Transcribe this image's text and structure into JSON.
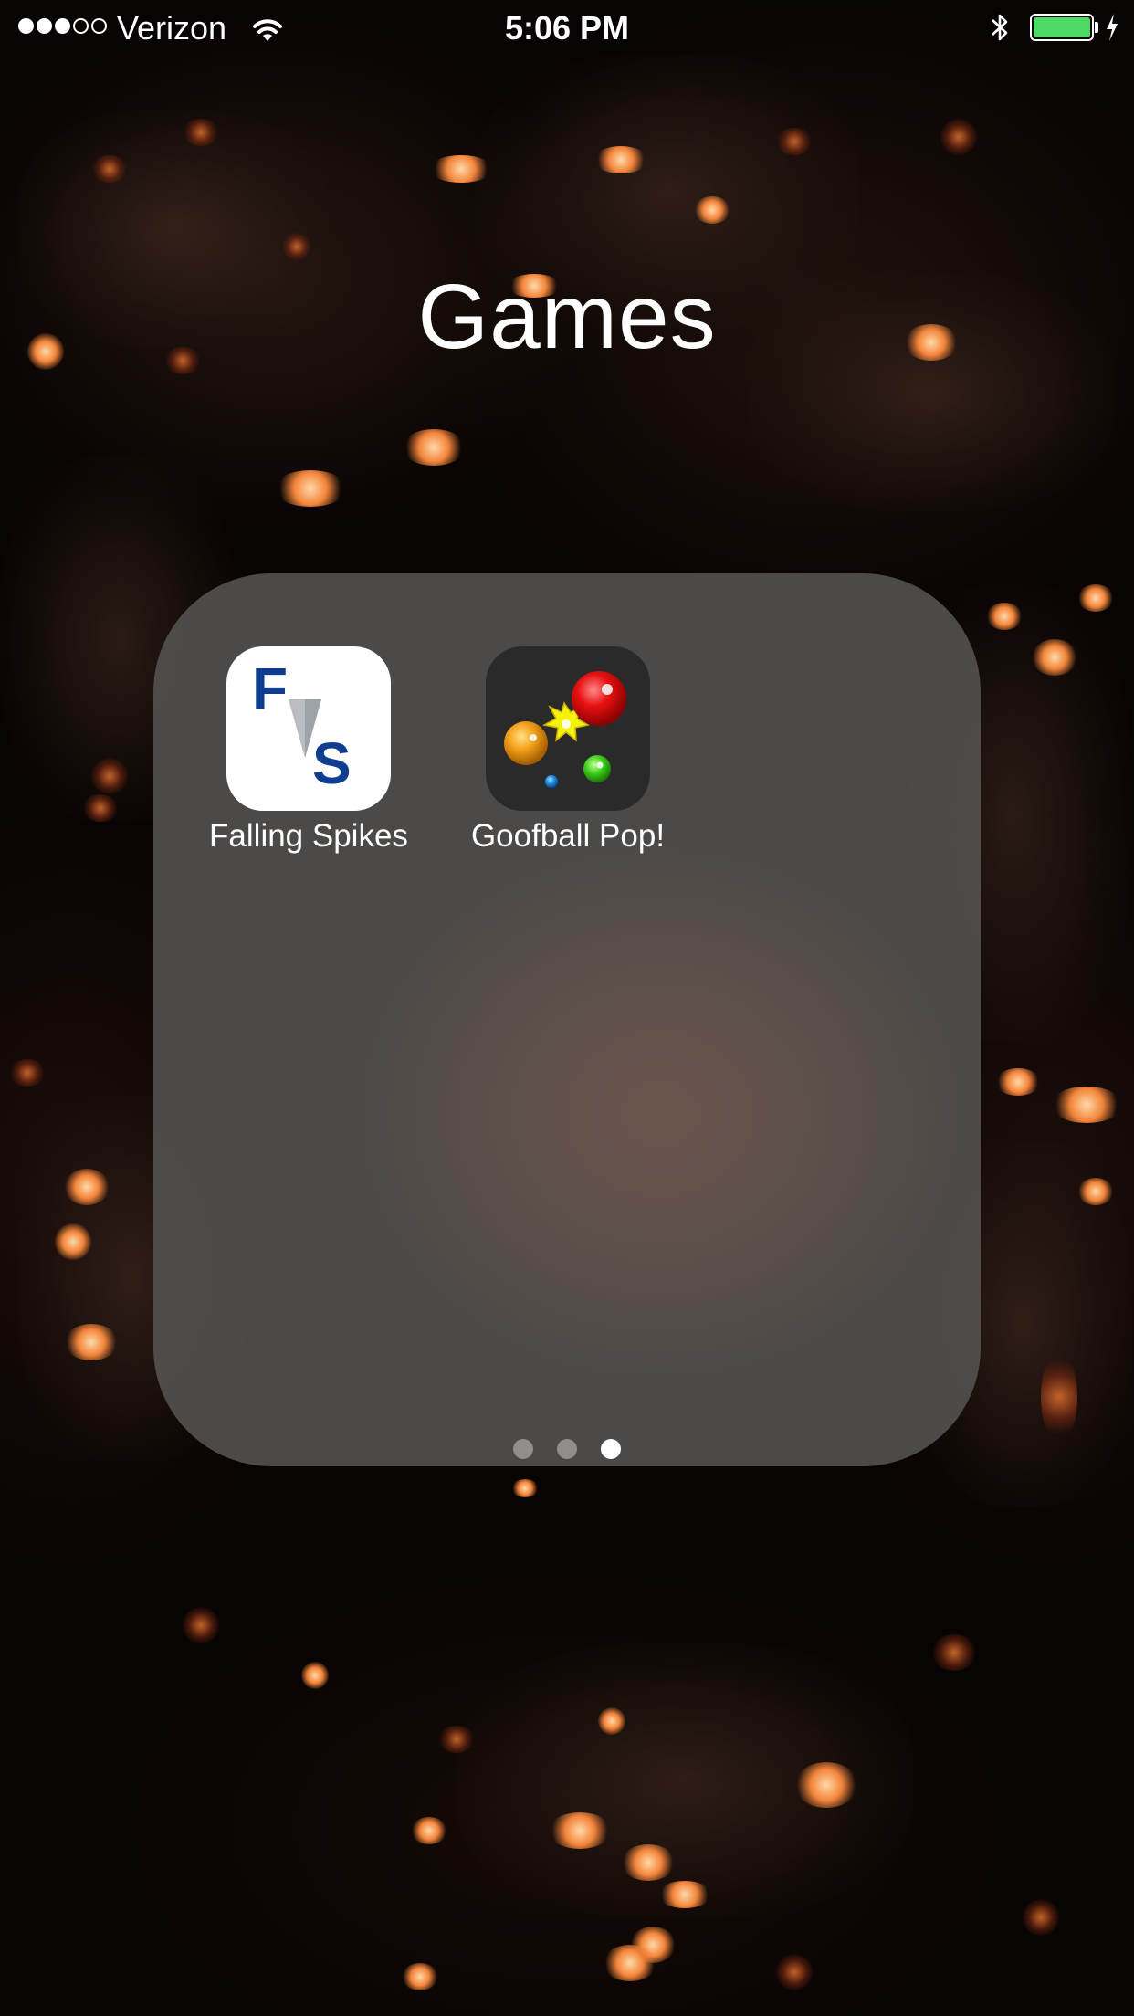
{
  "status_bar": {
    "signal_bars_filled": 3,
    "signal_bars_total": 5,
    "carrier": "Verizon",
    "time": "5:06 PM",
    "battery_level": 1.0,
    "charging": true,
    "bluetooth": true
  },
  "folder": {
    "title": "Games",
    "apps": [
      {
        "label": "Falling Spikes",
        "icon": "falling-spikes-icon"
      },
      {
        "label": "Goofball Pop!",
        "icon": "goofball-pop-icon"
      }
    ],
    "page_count": 3,
    "current_page": 3
  },
  "colors": {
    "battery": "#4cd964",
    "fs_blue": "#0f3e8f",
    "folder_bg": "#52504e"
  }
}
